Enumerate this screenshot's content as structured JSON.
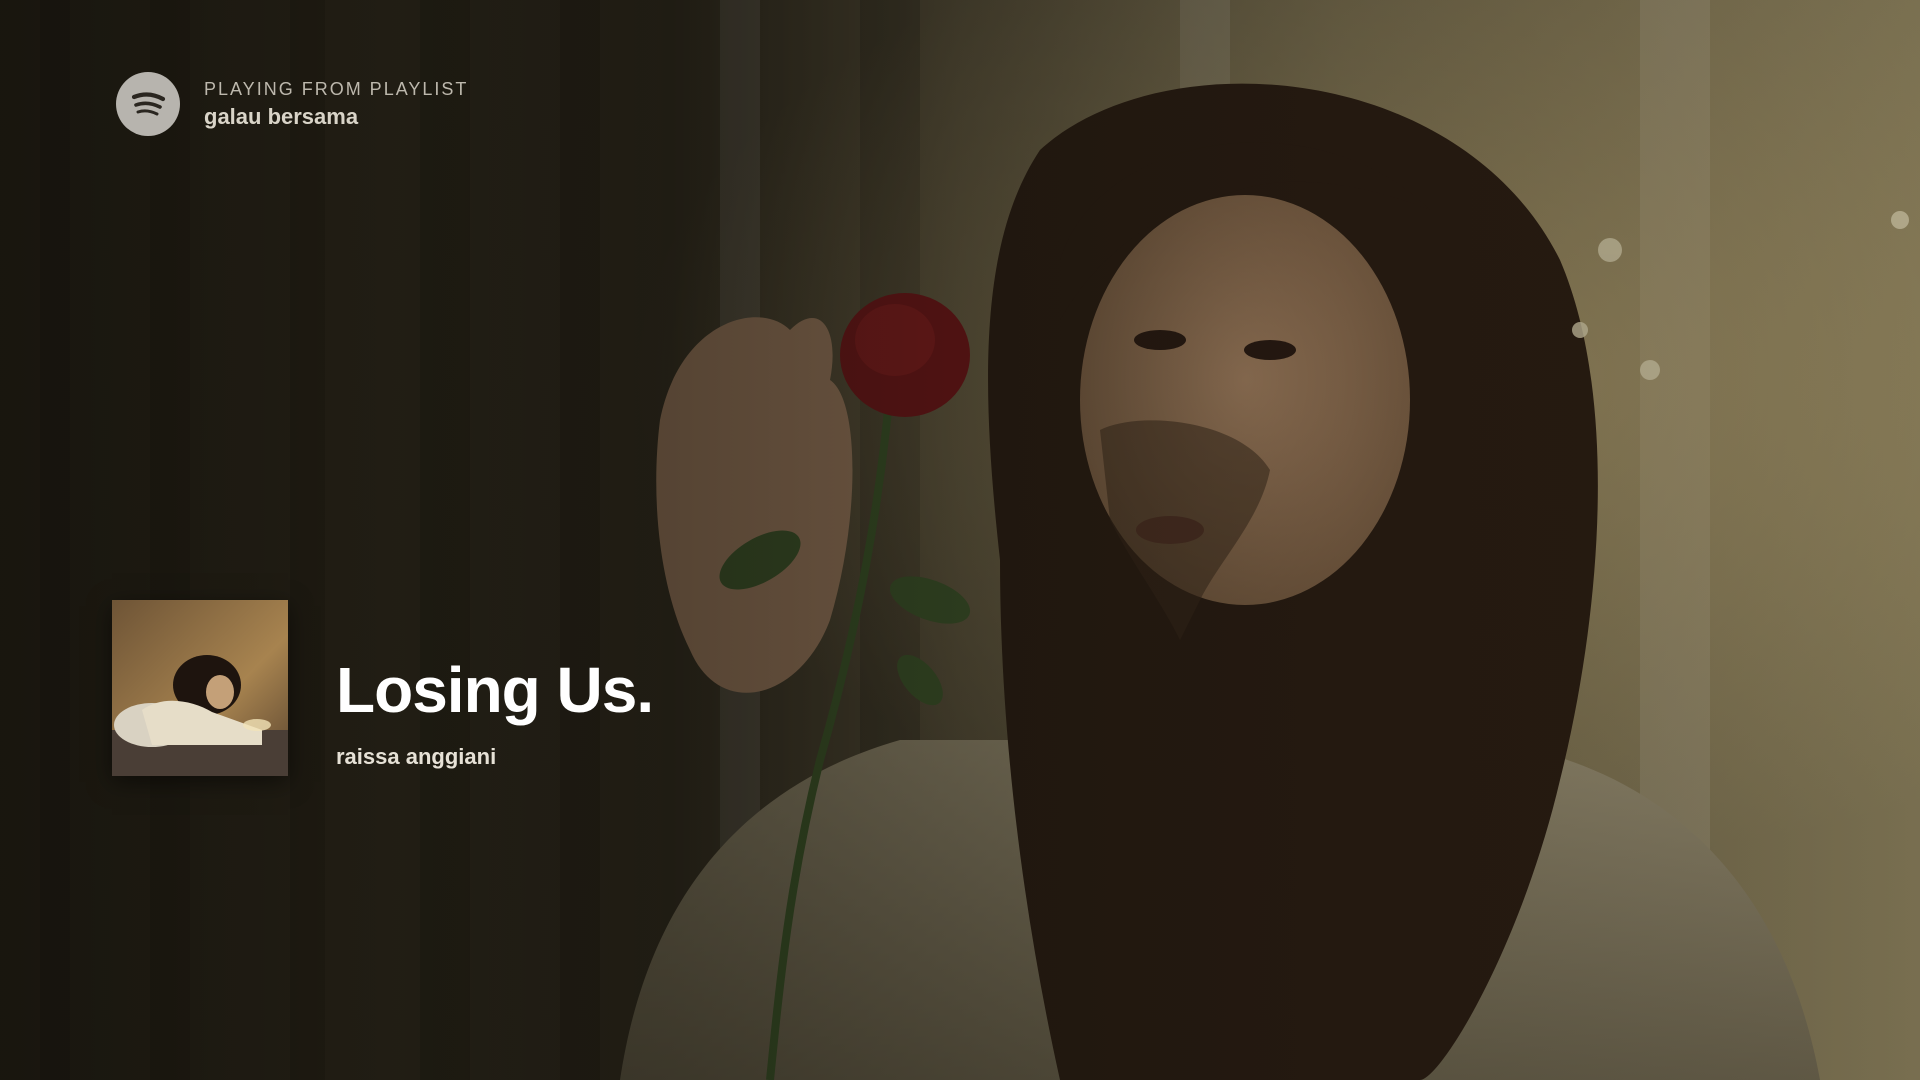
{
  "context": {
    "label": "PLAYING FROM PLAYLIST",
    "name": "galau bersama",
    "logo_icon": "spotify-logo-icon"
  },
  "track": {
    "title": "Losing Us.",
    "artist": "raissa anggiani",
    "cover_icon": "album-cover-image"
  },
  "background": {
    "icon": "artist-background-image"
  },
  "colors": {
    "background_base": "#1c1912",
    "logo_fill": "#b7b4ae",
    "title_text": "#ffffff",
    "secondary_text": "#bdb8ad"
  }
}
